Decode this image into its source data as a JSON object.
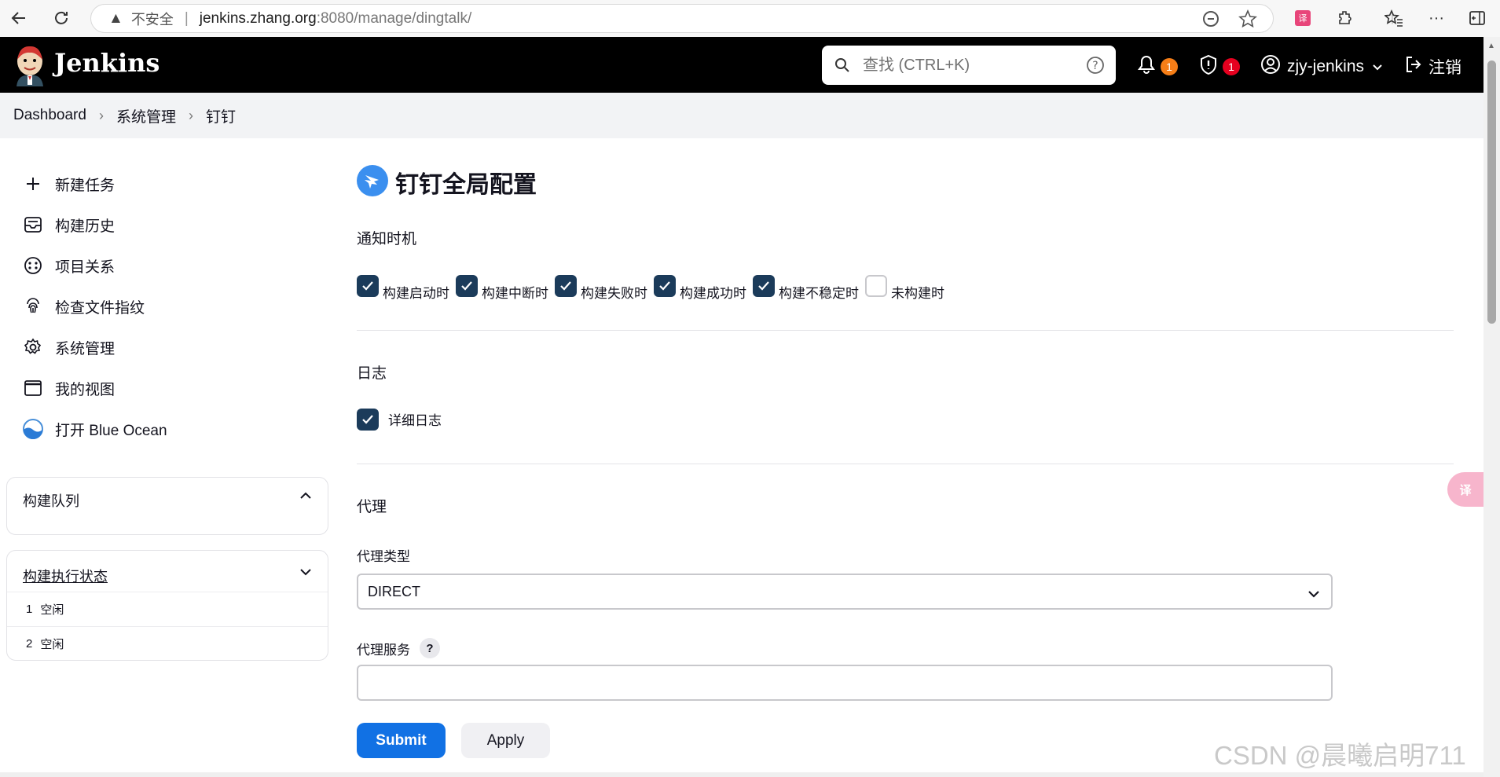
{
  "browser": {
    "security_label": "不安全",
    "url_host": "jenkins.zhang.org",
    "url_rest": ":8080/manage/dingtalk/"
  },
  "header": {
    "brand": "Jenkins",
    "search_placeholder": "查找 (CTRL+K)",
    "notifications_count": "1",
    "security_count": "1",
    "username": "zjy-jenkins",
    "logout_label": "注销",
    "notification_color": "#f67e17",
    "security_color": "#e6001f"
  },
  "breadcrumb": {
    "items": [
      "Dashboard",
      "系统管理",
      "钉钉"
    ]
  },
  "sidebar": {
    "tasks": [
      {
        "label": "新建任务",
        "icon": "plus-icon"
      },
      {
        "label": "构建历史",
        "icon": "inbox-icon"
      },
      {
        "label": "项目关系",
        "icon": "relations-icon"
      },
      {
        "label": "检查文件指纹",
        "icon": "fingerprint-icon"
      },
      {
        "label": "系统管理",
        "icon": "gear-icon"
      },
      {
        "label": "我的视图",
        "icon": "window-icon"
      },
      {
        "label": "打开 Blue Ocean",
        "icon": "blue-ocean-icon"
      }
    ],
    "build_queue": {
      "title": "构建队列"
    },
    "executors": {
      "title": "构建执行状态",
      "rows": [
        {
          "num": "1",
          "status": "空闲"
        },
        {
          "num": "2",
          "status": "空闲"
        }
      ]
    }
  },
  "main": {
    "title": "钉钉全局配置",
    "notify": {
      "title": "通知时机",
      "options": [
        {
          "label": "构建启动时",
          "checked": true
        },
        {
          "label": "构建中断时",
          "checked": true
        },
        {
          "label": "构建失败时",
          "checked": true
        },
        {
          "label": "构建成功时",
          "checked": true
        },
        {
          "label": "构建不稳定时",
          "checked": true
        },
        {
          "label": "未构建时",
          "checked": false
        }
      ]
    },
    "log": {
      "title": "日志",
      "verbose_label": "详细日志",
      "verbose_checked": true
    },
    "proxy": {
      "title": "代理",
      "type_label": "代理类型",
      "type_value": "DIRECT",
      "server_label": "代理服务",
      "server_help": "?",
      "server_value": ""
    }
  },
  "actions": {
    "submit_label": "Submit",
    "apply_label": "Apply"
  },
  "extras": {
    "translate_fab": "译",
    "watermark": "CSDN @晨曦启明711"
  },
  "colors": {
    "checkbox_checked": "#1b3b5a",
    "primary_button": "#1171e4",
    "header_bg": "#000000"
  }
}
